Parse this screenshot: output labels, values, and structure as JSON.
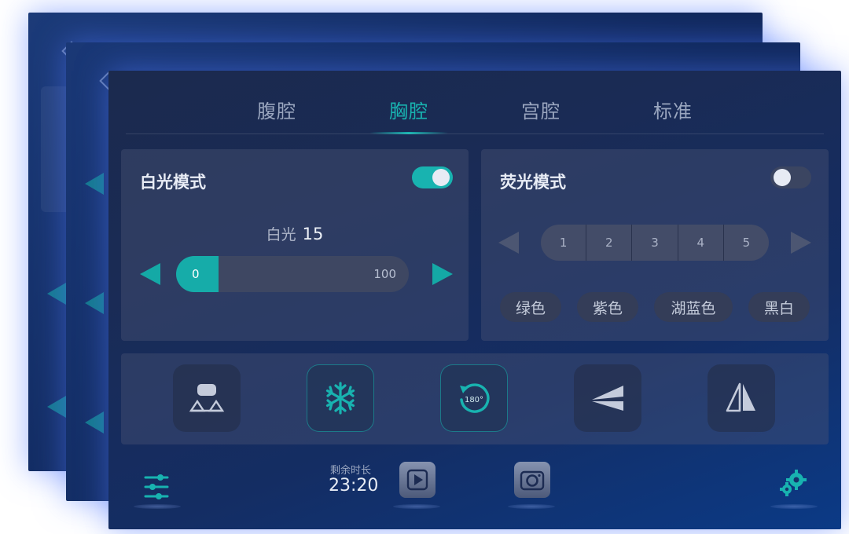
{
  "tabs": [
    {
      "label": "腹腔",
      "active": false
    },
    {
      "label": "胸腔",
      "active": true
    },
    {
      "label": "宫腔",
      "active": false
    },
    {
      "label": "标准",
      "active": false
    }
  ],
  "white_light": {
    "title": "白光模式",
    "toggle_on": true,
    "caption": "白光",
    "value": "15",
    "slider_min": "0",
    "slider_max": "100",
    "slider_level": 0
  },
  "fluorescence": {
    "title": "荧光模式",
    "toggle_on": false,
    "levels": [
      "1",
      "2",
      "3",
      "4",
      "5"
    ],
    "colors": [
      "绿色",
      "紫色",
      "湖蓝色",
      "黑白"
    ]
  },
  "tools": [
    {
      "icon": "image-flip-icon"
    },
    {
      "icon": "snowflake-icon"
    },
    {
      "icon": "rotate-180-icon",
      "label": "180°"
    },
    {
      "icon": "wedge-icon"
    },
    {
      "icon": "mirror-icon"
    }
  ],
  "footer": {
    "time_label": "剩余时长",
    "time_value": "23:20"
  },
  "colors": {
    "accent": "#18b3b0",
    "panel": "#4a5474"
  }
}
